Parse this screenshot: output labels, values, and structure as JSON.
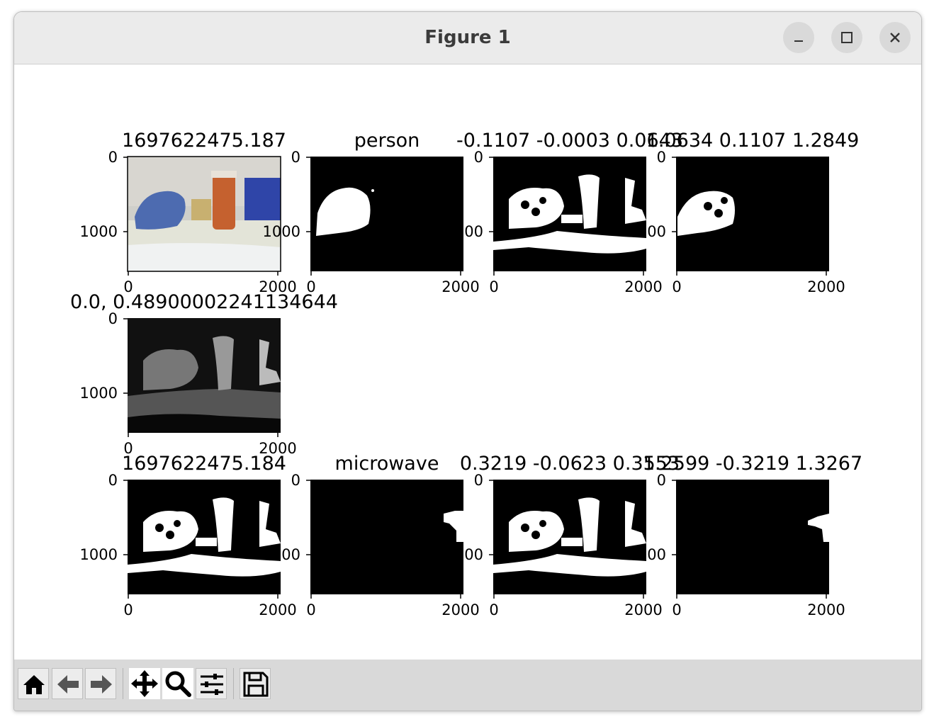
{
  "window": {
    "title": "Figure 1"
  },
  "figure": {
    "row1": {
      "titles": [
        "1697622475.187",
        "person",
        "-0.1107 -0.0003 0.0643",
        "1.0634 0.1107 1.2849"
      ]
    },
    "row2": {
      "titles": [
        "0.0, 0.48900002241134644"
      ]
    },
    "row3": {
      "titles": [
        "1697622475.184",
        "microwave",
        "0.3219 -0.0623 0.3553",
        "1.2599 -0.3219 1.3267"
      ]
    },
    "ticks": {
      "y0": "0",
      "y1000": "1000",
      "x0": "0",
      "x2000": "2000"
    }
  },
  "toolbar": {
    "icons": [
      "home-icon",
      "back-arrow-icon",
      "forward-arrow-icon",
      "pan-move-icon",
      "zoom-magnifier-icon",
      "configure-subplots-icon",
      "save-floppy-icon"
    ]
  },
  "colors": {
    "titlebar": "#ebebeb",
    "toolbar": "#d9d9d9",
    "mask_fg": "#ffffff",
    "mask_bg": "#000000"
  }
}
